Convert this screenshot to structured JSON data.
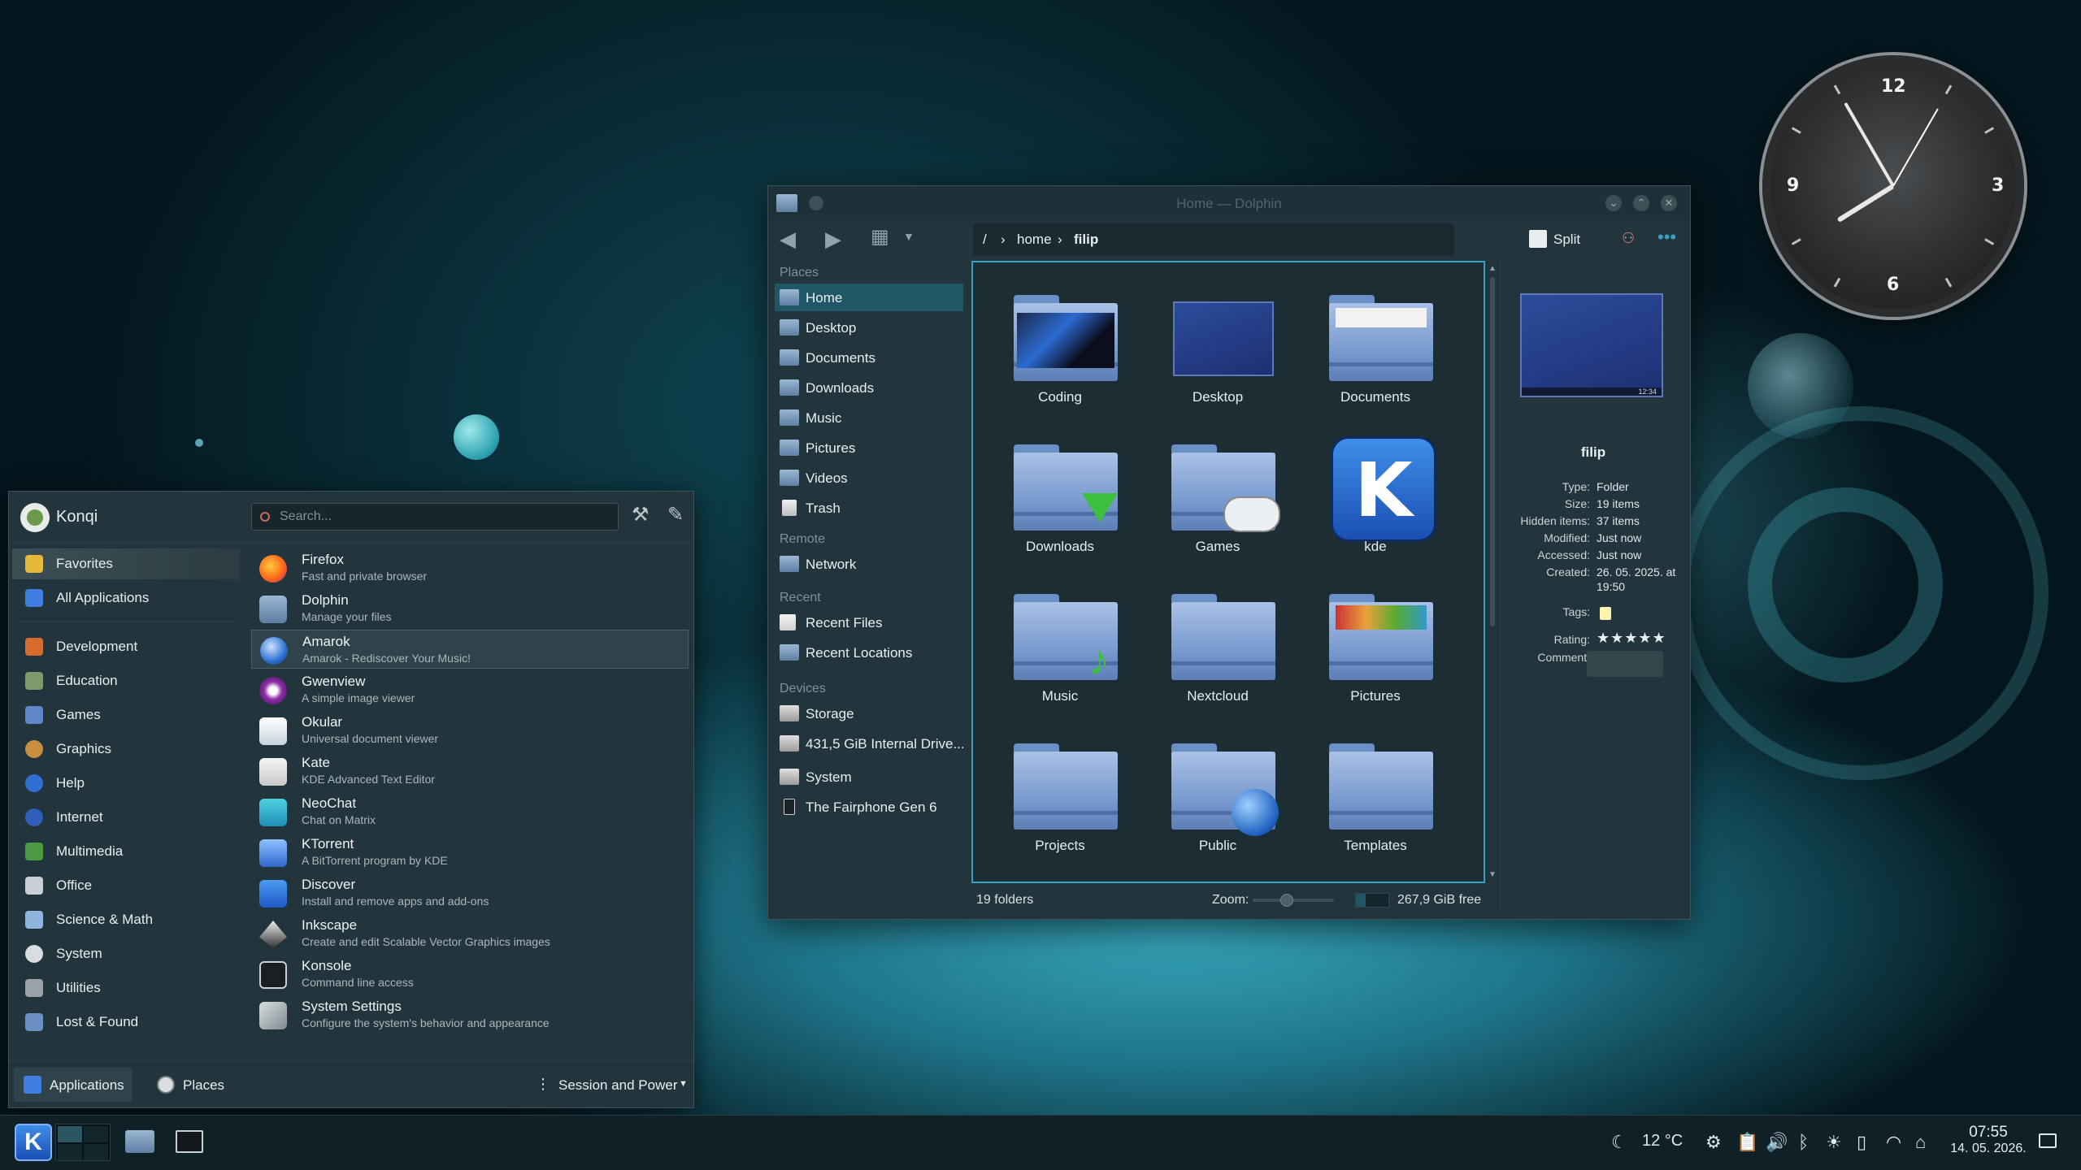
{
  "colors": {
    "accent": "#3b9fbf",
    "window_bg": "#22353c",
    "panel_bg": "#0f2026"
  },
  "dolphin": {
    "title": "Home — Dolphin",
    "breadcrumb": {
      "root": "/",
      "sep": "›",
      "home": "home",
      "current": "filip"
    },
    "split_label": "Split",
    "places": {
      "heading": "Places",
      "items": [
        "Home",
        "Desktop",
        "Documents",
        "Downloads",
        "Music",
        "Pictures",
        "Videos",
        "Trash"
      ],
      "remote_heading": "Remote",
      "remote_items": [
        "Network"
      ],
      "recent_heading": "Recent",
      "recent_items": [
        "Recent Files",
        "Recent Locations"
      ],
      "devices_heading": "Devices",
      "devices_items": [
        "Storage",
        "431,5 GiB Internal Drive...",
        "System",
        "The Fairphone Gen 6"
      ]
    },
    "folders": [
      "Coding",
      "Desktop",
      "Documents",
      "Downloads",
      "Games",
      "kde",
      "Music",
      "Nextcloud",
      "Pictures",
      "Projects",
      "Public",
      "Templates"
    ],
    "status": {
      "count": "19 folders",
      "zoom_label": "Zoom:",
      "free": "267,9 GiB free"
    },
    "info": {
      "name": "filip",
      "thumb_time": "12:34",
      "type_k": "Type:",
      "type_v": "Folder",
      "size_k": "Size:",
      "size_v": "19 items",
      "hidden_k": "Hidden items:",
      "hidden_v": "37 items",
      "modified_k": "Modified:",
      "modified_v": "Just now",
      "accessed_k": "Accessed:",
      "accessed_v": "Just now",
      "created_k": "Created:",
      "created_v": "26. 05. 2025. at",
      "created_v2": "19:50",
      "tags_k": "Tags:",
      "rating_k": "Rating:",
      "rating_v": "★★★★★",
      "comment_k": "Comment:"
    }
  },
  "kickoff": {
    "user": "Konqi",
    "search_placeholder": "Search...",
    "categories": [
      "Favorites",
      "All Applications",
      "Development",
      "Education",
      "Games",
      "Graphics",
      "Help",
      "Internet",
      "Multimedia",
      "Office",
      "Science & Math",
      "System",
      "Utilities",
      "Lost & Found"
    ],
    "apps": [
      {
        "name": "Firefox",
        "desc": "Fast and private browser"
      },
      {
        "name": "Dolphin",
        "desc": "Manage your files"
      },
      {
        "name": "Amarok",
        "desc": "Amarok - Rediscover Your Music!"
      },
      {
        "name": "Gwenview",
        "desc": "A simple image viewer"
      },
      {
        "name": "Okular",
        "desc": "Universal document viewer"
      },
      {
        "name": "Kate",
        "desc": "KDE Advanced Text Editor"
      },
      {
        "name": "NeoChat",
        "desc": "Chat on Matrix"
      },
      {
        "name": "KTorrent",
        "desc": "A BitTorrent program by KDE"
      },
      {
        "name": "Discover",
        "desc": "Install and remove apps and add-ons"
      },
      {
        "name": "Inkscape",
        "desc": "Create and edit Scalable Vector Graphics images"
      },
      {
        "name": "Konsole",
        "desc": "Command line access"
      },
      {
        "name": "System Settings",
        "desc": "Configure the system's behavior and appearance"
      }
    ],
    "footer": {
      "applications": "Applications",
      "places": "Places",
      "session": "Session and Power"
    }
  },
  "clock": {
    "num12": "12",
    "num3": "3",
    "num6": "6",
    "num9": "9"
  },
  "panel": {
    "weather": "12 °C",
    "time": "07:55",
    "date": "14. 05. 2026."
  }
}
